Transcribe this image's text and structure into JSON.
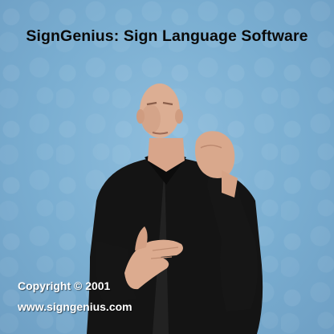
{
  "video": {
    "title": "SignGenius: Sign Language Software",
    "copyright": "Copyright © 2001",
    "website": "www.signgenius.com"
  }
}
